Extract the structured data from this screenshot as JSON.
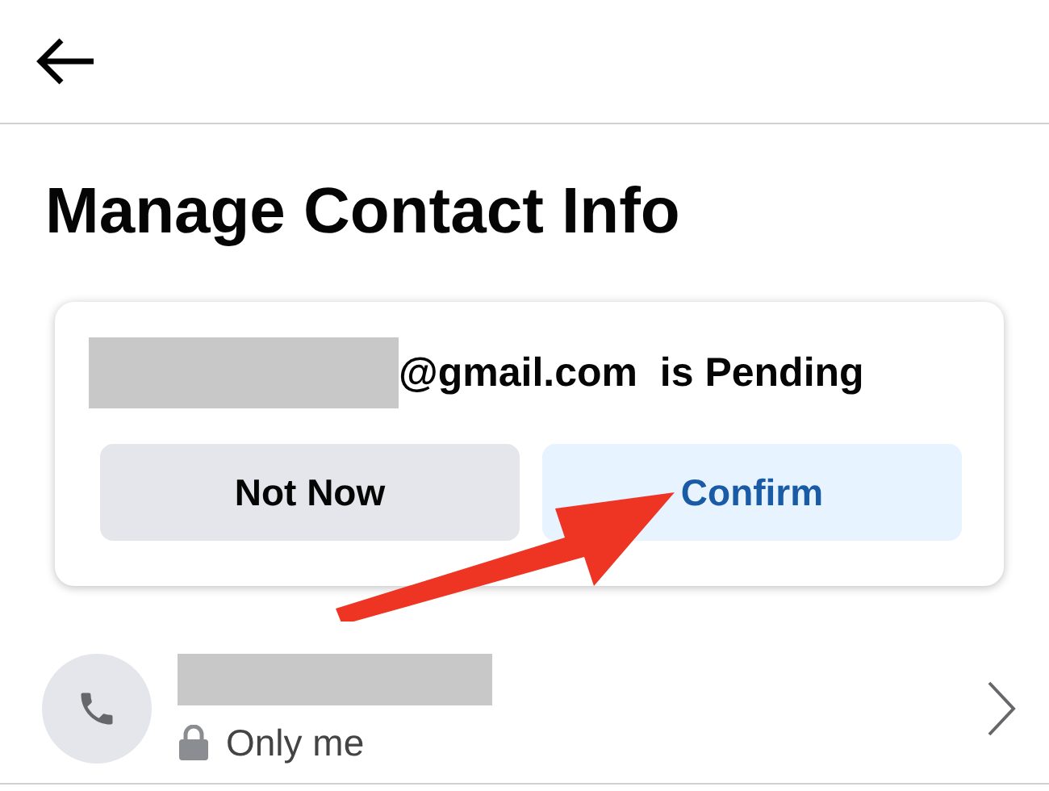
{
  "title": "Manage Contact Info",
  "pending_card": {
    "message": "@gmail.com  is Pending",
    "buttons": [
      {
        "label": "Not Now",
        "kind": "secondary"
      },
      {
        "label": "Confirm",
        "kind": "primary"
      }
    ]
  },
  "contact_row": {
    "privacy": "Only me"
  }
}
